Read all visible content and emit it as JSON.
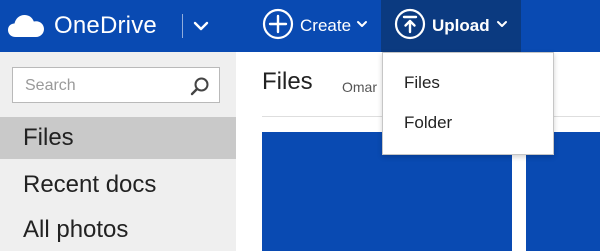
{
  "header": {
    "app_name": "OneDrive",
    "create_label": "Create",
    "upload_label": "Upload",
    "colors": {
      "bar": "#094ab2",
      "upload_active": "#0b3a80"
    }
  },
  "sidebar": {
    "search": {
      "placeholder": "Search",
      "value": ""
    },
    "items": [
      {
        "label": "Files",
        "active": true
      },
      {
        "label": "Recent docs",
        "active": false
      },
      {
        "label": "All photos",
        "active": false
      }
    ]
  },
  "main": {
    "title": "Files",
    "owner": "Omar"
  },
  "upload_menu": {
    "items": [
      {
        "label": "Files"
      },
      {
        "label": "Folder"
      }
    ]
  },
  "icons": {
    "logo": "cloud-logo-icon",
    "logo_menu": "chevron-down-icon",
    "create": "plus-circle-icon",
    "upload": "upload-circle-icon",
    "search": "search-icon"
  }
}
